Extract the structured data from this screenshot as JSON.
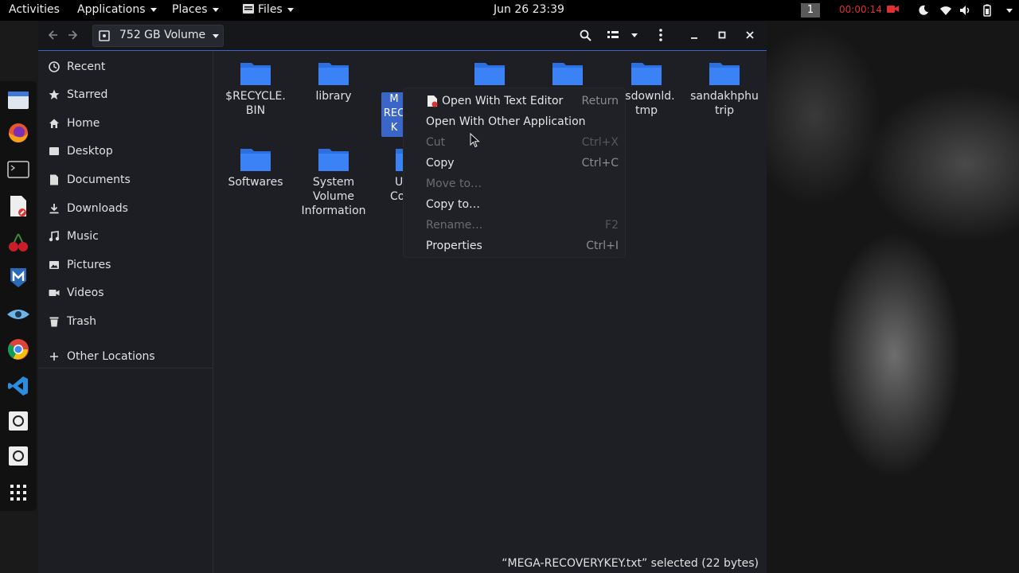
{
  "topbar": {
    "activities": "Activities",
    "applications": "Applications",
    "places": "Places",
    "files": "Files",
    "datetime": "Jun 26  23:39",
    "workspace": "1",
    "recording_time": "00:00:14"
  },
  "window": {
    "location": "752 GB Volume",
    "accent_color": "#3a66c8"
  },
  "sidebar": {
    "items": [
      {
        "label": "Recent",
        "icon": "clock-icon"
      },
      {
        "label": "Starred",
        "icon": "star-icon"
      },
      {
        "label": "Home",
        "icon": "home-icon"
      },
      {
        "label": "Desktop",
        "icon": "desktop-icon"
      },
      {
        "label": "Documents",
        "icon": "document-icon"
      },
      {
        "label": "Downloads",
        "icon": "download-icon"
      },
      {
        "label": "Music",
        "icon": "music-icon"
      },
      {
        "label": "Pictures",
        "icon": "picture-icon"
      },
      {
        "label": "Videos",
        "icon": "video-icon"
      },
      {
        "label": "Trash",
        "icon": "trash-icon"
      }
    ],
    "other_locations": "Other Locations"
  },
  "files": [
    {
      "line1": "$RECYCLE.",
      "line2": "BIN",
      "line3": ""
    },
    {
      "line1": "library",
      "line2": "",
      "line3": ""
    },
    {
      "line1": "nsdownld.",
      "line2": "tmp",
      "line3": ""
    },
    {
      "line1": "sandakhphu",
      "line2": "trip",
      "line3": ""
    },
    {
      "line1": "Softwares",
      "line2": "",
      "line3": ""
    },
    {
      "line1": "System",
      "line2": "Volume",
      "line3": "Information"
    }
  ],
  "partial_labels": {
    "selected": [
      "M",
      "REC",
      "K"
    ],
    "hidden": [
      "U",
      "Co"
    ]
  },
  "context_menu": [
    {
      "label": "Open With Text Editor",
      "accel": "Return",
      "disabled": false
    },
    {
      "label": "Open With Other Application",
      "accel": "",
      "disabled": false
    },
    {
      "label": "Cut",
      "accel": "Ctrl+X",
      "disabled": true
    },
    {
      "label": "Copy",
      "accel": "Ctrl+C",
      "disabled": false
    },
    {
      "label": "Move to…",
      "accel": "",
      "disabled": true
    },
    {
      "label": "Copy to…",
      "accel": "",
      "disabled": false
    },
    {
      "label": "Rename…",
      "accel": "F2",
      "disabled": true
    },
    {
      "label": "Properties",
      "accel": "Ctrl+I",
      "disabled": false
    }
  ],
  "status": "“MEGA-RECOVERYKEY.txt” selected  (22 bytes)"
}
